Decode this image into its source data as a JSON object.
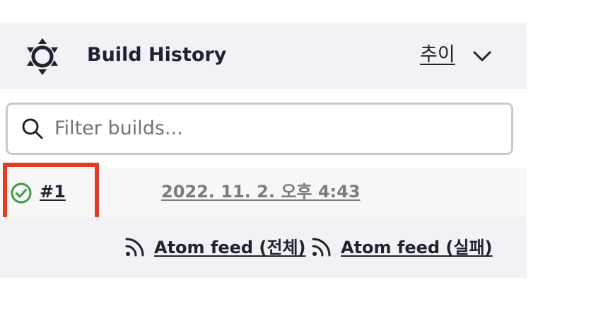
{
  "header": {
    "title": "Build History",
    "trend_label": "추이",
    "logo_icon": "jenkins-build-history-icon",
    "chevron_icon": "chevron-down-icon"
  },
  "search": {
    "placeholder": "Filter builds...",
    "value": ""
  },
  "builds": [
    {
      "number": "#1",
      "status": "success",
      "status_icon": "check-circle-icon",
      "status_color": "#3b9d48",
      "date": "2022. 11. 2. 오후 4:43"
    }
  ],
  "feeds": {
    "all_label": "Atom feed (전체)",
    "failed_label": "Atom feed (실패)",
    "icon": "rss-icon"
  },
  "colors": {
    "header_bg": "#f2f2f6",
    "highlight": "#e23c24",
    "search_border": "#c5cbd2",
    "success": "#3b9d48"
  }
}
